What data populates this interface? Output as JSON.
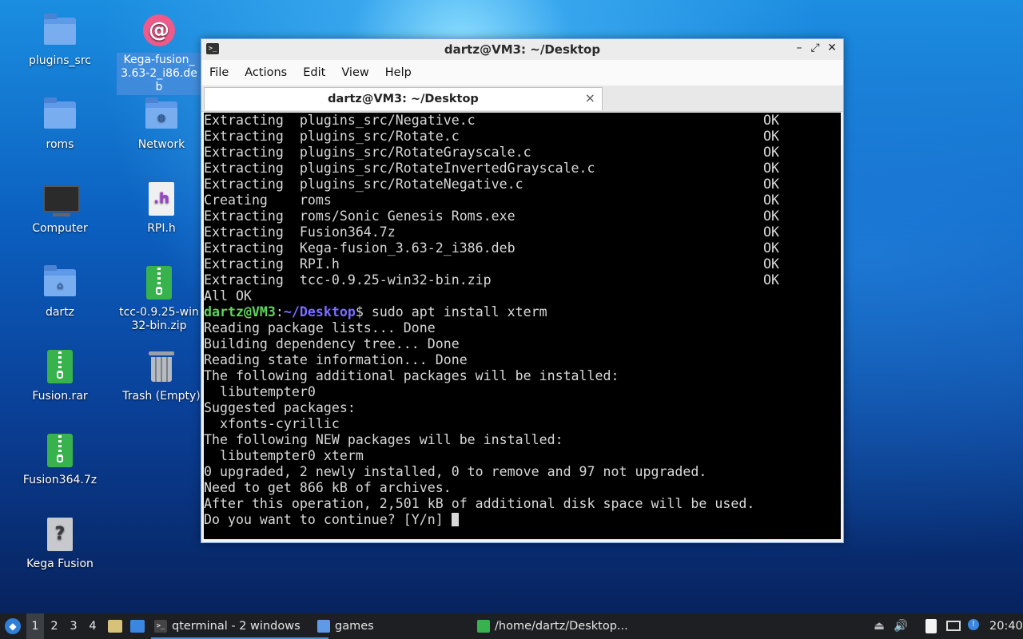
{
  "desktop_icons": {
    "plugins_src": "plugins_src",
    "kega_deb": "Kega-fusion_3.63-2_i86.deb",
    "roms": "roms",
    "network": "Network",
    "computer": "Computer",
    "rpi_h": "RPI.h",
    "dartz": "dartz",
    "tcc_zip": "tcc-0.9.25-win32-bin.zip",
    "fusion_rar": "Fusion.rar",
    "trash": "Trash (Empty)",
    "fusion_7z": "Fusion364.7z",
    "kega_fusion": "Kega Fusion"
  },
  "window": {
    "title": "dartz@VM3: ~/Desktop",
    "menu": [
      "File",
      "Actions",
      "Edit",
      "View",
      "Help"
    ],
    "tab_title": "dartz@VM3: ~/Desktop"
  },
  "terminal": {
    "extract_lines": [
      {
        "text": "Extracting  plugins_src/Negative.c",
        "status": "OK"
      },
      {
        "text": "Extracting  plugins_src/Rotate.c",
        "status": "OK"
      },
      {
        "text": "Extracting  plugins_src/RotateGrayscale.c",
        "status": "OK"
      },
      {
        "text": "Extracting  plugins_src/RotateInvertedGrayscale.c",
        "status": "OK"
      },
      {
        "text": "Extracting  plugins_src/RotateNegative.c",
        "status": "OK"
      },
      {
        "text": "Creating    roms",
        "status": "OK"
      },
      {
        "text": "Extracting  roms/Sonic Genesis Roms.exe",
        "status": "OK"
      },
      {
        "text": "Extracting  Fusion364.7z",
        "status": "OK"
      },
      {
        "text": "Extracting  Kega-fusion_3.63-2_i386.deb",
        "status": "OK"
      },
      {
        "text": "Extracting  RPI.h",
        "status": "OK"
      },
      {
        "text": "Extracting  tcc-0.9.25-win32-bin.zip",
        "status": "OK"
      }
    ],
    "all_ok": "All OK",
    "prompt_user": "dartz@VM3",
    "prompt_sep": ":",
    "prompt_path": "~/Desktop",
    "prompt_end": "$ ",
    "command": "sudo apt install xterm",
    "output_lines": [
      "Reading package lists... Done",
      "Building dependency tree... Done",
      "Reading state information... Done",
      "The following additional packages will be installed:",
      "  libutempter0",
      "Suggested packages:",
      "  xfonts-cyrillic",
      "The following NEW packages will be installed:",
      "  libutempter0 xterm",
      "0 upgraded, 2 newly installed, 0 to remove and 97 not upgraded.",
      "Need to get 866 kB of archives.",
      "After this operation, 2,501 kB of additional disk space will be used."
    ],
    "question": "Do you want to continue? [Y/n] "
  },
  "taskbar": {
    "workspaces": [
      "1",
      "2",
      "3",
      "4"
    ],
    "qterminal": "qterminal - 2 windows",
    "games": "games",
    "filemanager": "/home/dartz/Desktop...",
    "clock": "20:40"
  },
  "colors": {
    "prompt_user": "#5fd35f",
    "prompt_path": "#7b6dff",
    "terminal_bg": "#000000",
    "taskbar_bg": "#1d1f22"
  }
}
